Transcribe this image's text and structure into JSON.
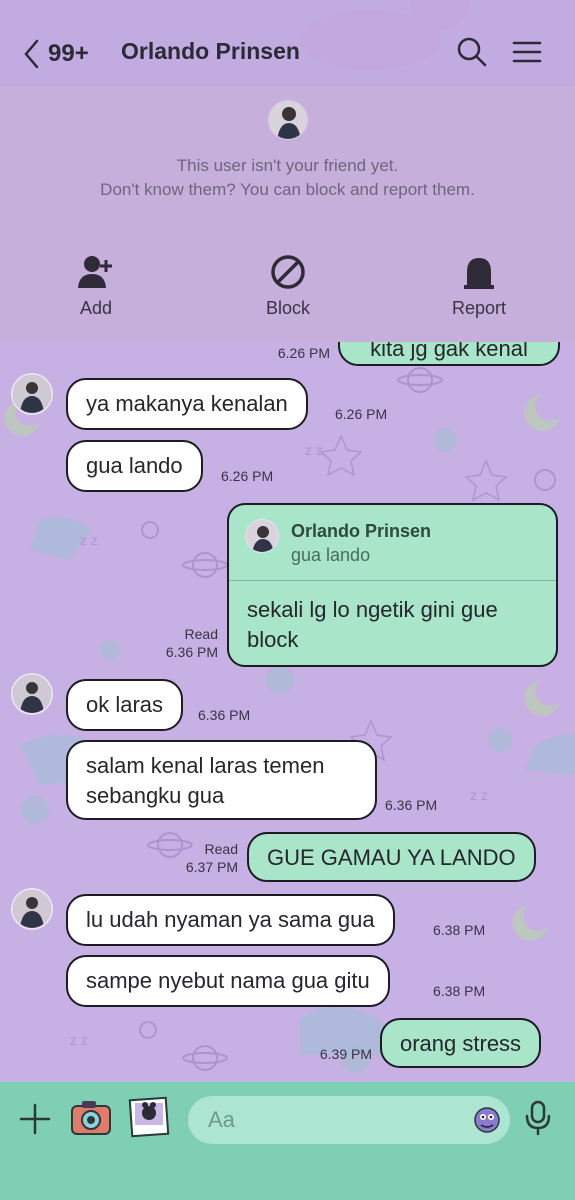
{
  "header": {
    "unread_count": "99+",
    "title": "Orlando Prinsen"
  },
  "stranger_notice": {
    "line1": "This user isn't your friend yet.",
    "line2": "Don't know them? You can block and report them.",
    "actions": [
      {
        "label": "Add",
        "icon": "add-friend-icon"
      },
      {
        "label": "Block",
        "icon": "block-icon"
      },
      {
        "label": "Report",
        "icon": "report-icon"
      }
    ]
  },
  "messages": [
    {
      "side": "out",
      "text": "kita jg gak kenal",
      "time": "6.26 PM"
    },
    {
      "side": "in",
      "text": "ya makanya kenalan",
      "time": "6.26 PM"
    },
    {
      "side": "in",
      "text": "gua lando",
      "time": "6.26 PM"
    },
    {
      "side": "out",
      "reply_to": {
        "name": "Orlando Prinsen",
        "text": "gua lando"
      },
      "text": "sekali lg lo ngetik gini gue block",
      "read": "Read",
      "time": "6.36 PM"
    },
    {
      "side": "in",
      "text": "ok laras",
      "time": "6.36 PM"
    },
    {
      "side": "in",
      "text_lines": [
        "salam kenal laras temen",
        "sebangku gua"
      ],
      "time": "6.36 PM"
    },
    {
      "side": "out",
      "text": "GUE GAMAU YA LANDO",
      "read": "Read",
      "time": "6.37 PM"
    },
    {
      "side": "in",
      "text": "lu udah nyaman ya sama gua",
      "time": "6.38 PM"
    },
    {
      "side": "in",
      "text": "sampe nyebut nama gua gitu",
      "time": "6.38 PM"
    },
    {
      "side": "out",
      "text": "orang stress",
      "time": "6.39 PM"
    }
  ],
  "input": {
    "placeholder": "Aa"
  },
  "colors": {
    "background": "#c7b0e4",
    "outgoing_bubble": "#a8e5c9",
    "incoming_bubble": "#ffffff",
    "bottom_bar": "#7fcfb5"
  }
}
